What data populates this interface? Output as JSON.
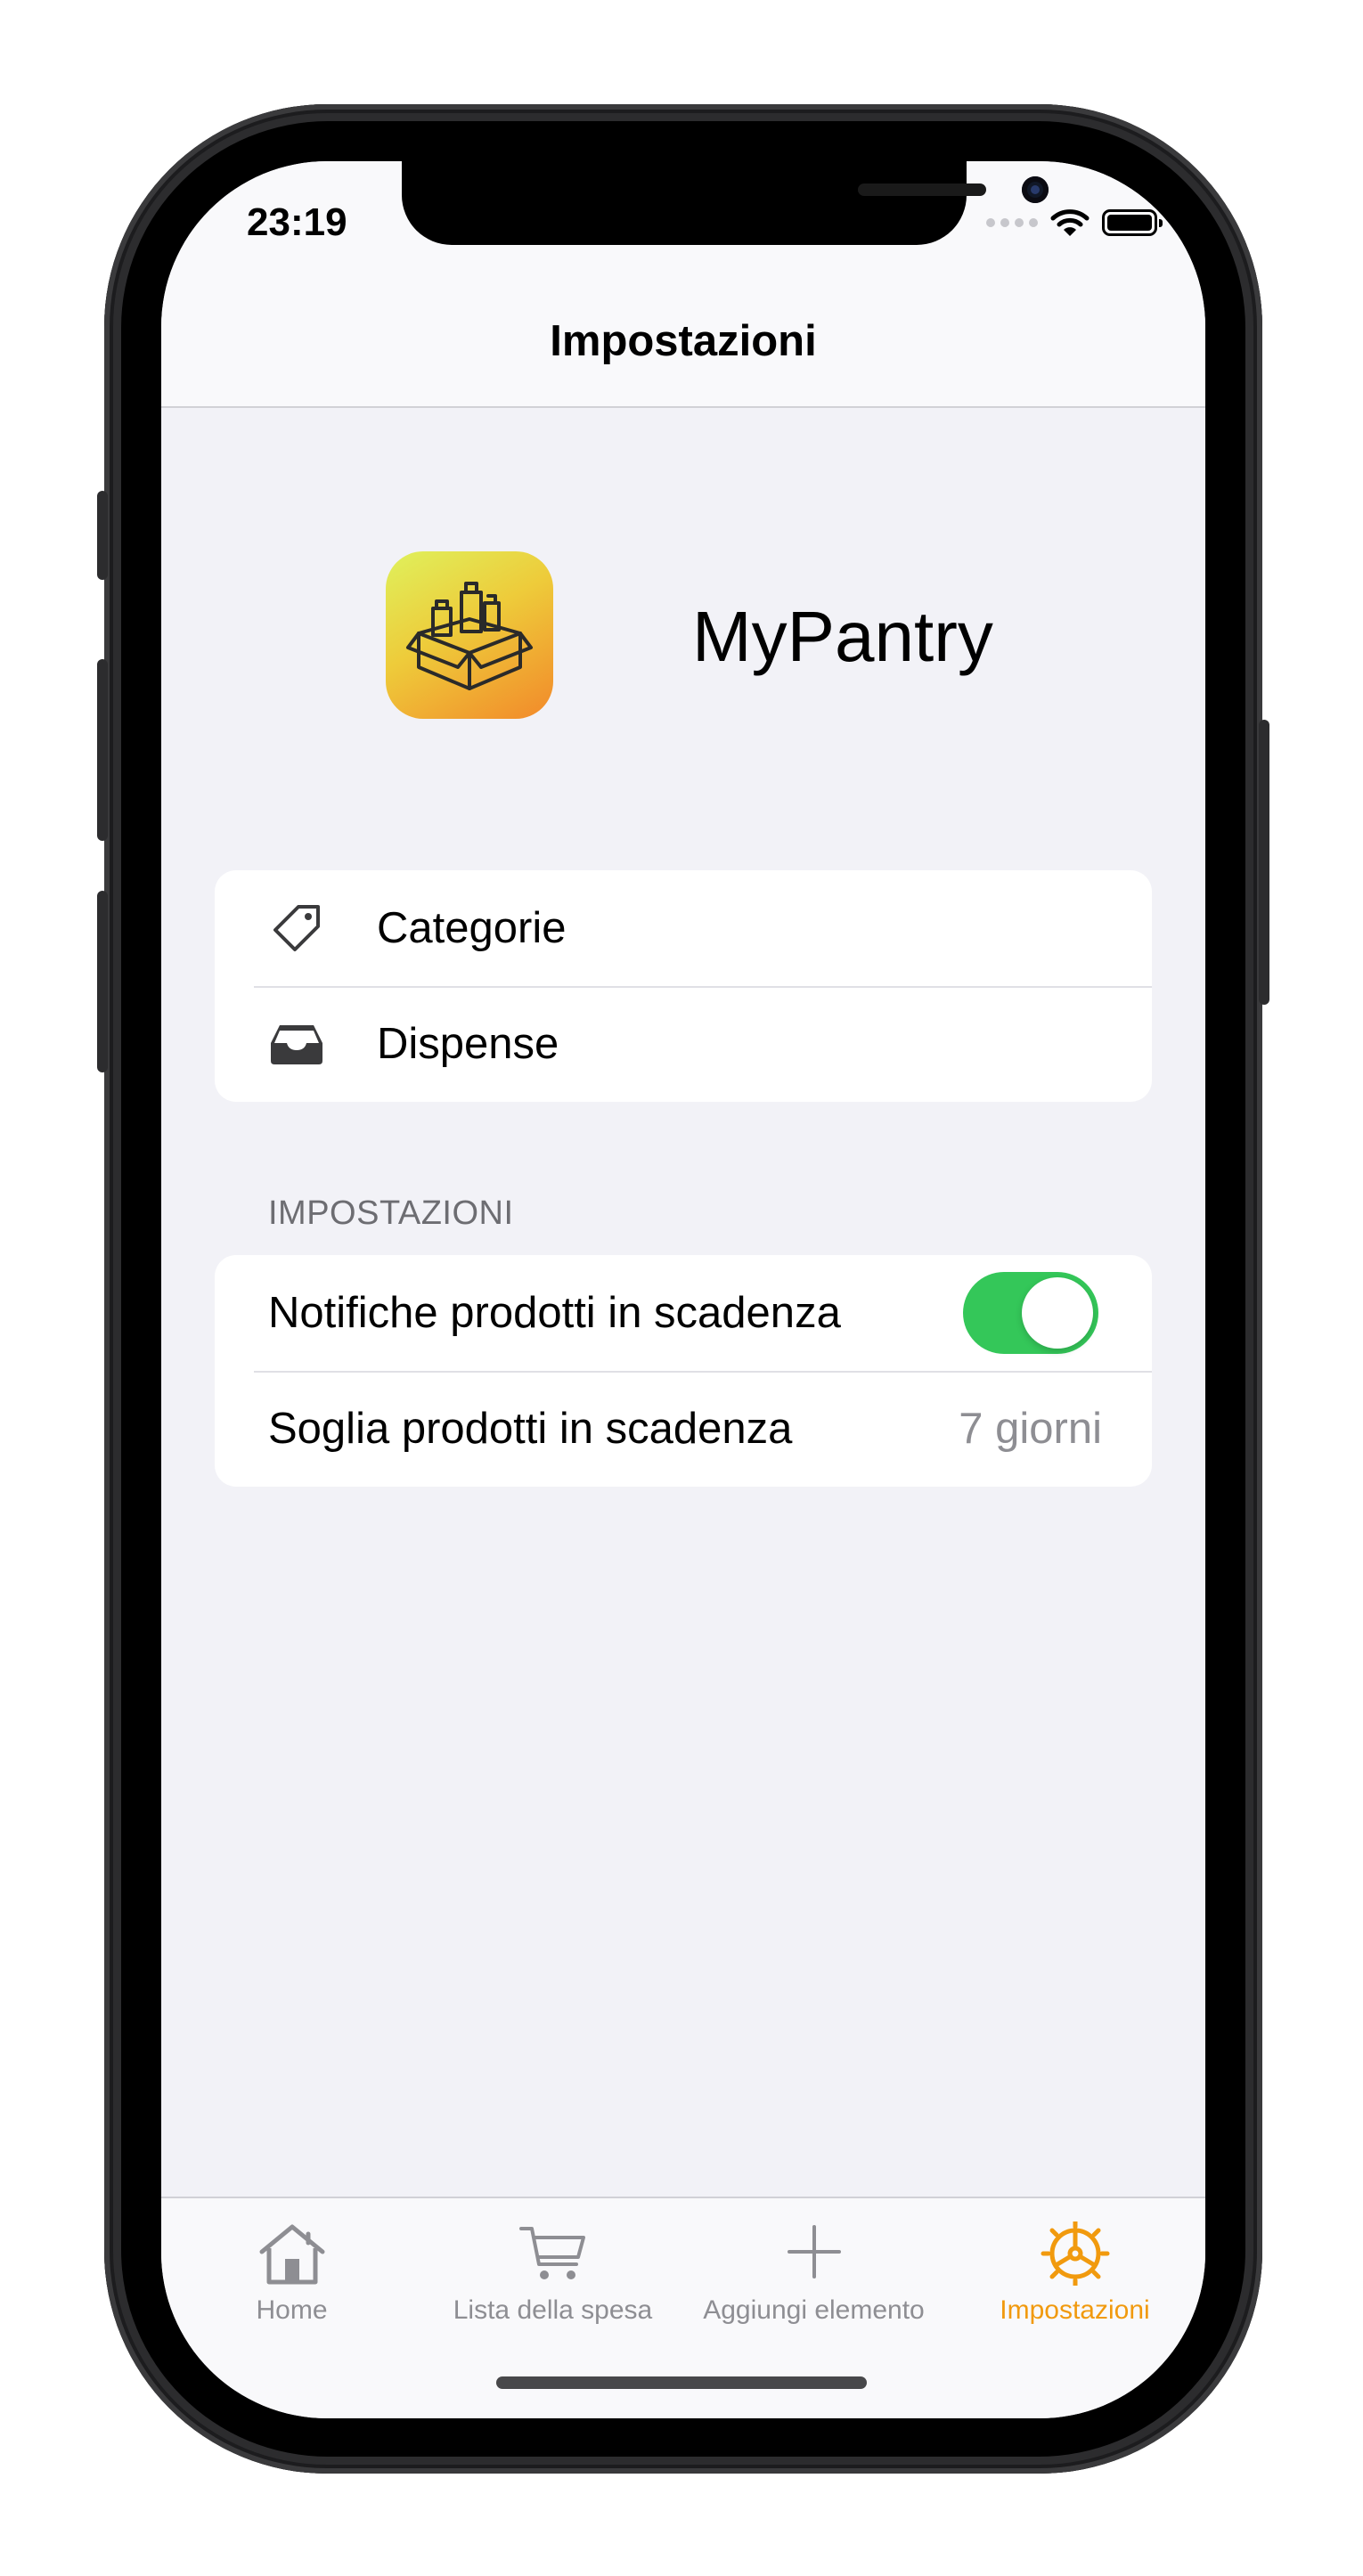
{
  "status_bar": {
    "time": "23:19"
  },
  "nav": {
    "title": "Impostazioni"
  },
  "app": {
    "name": "MyPantry",
    "icon": "pantry-box-icon",
    "icon_gradient": [
      "#dff15c",
      "#eecb3a",
      "#f2892a"
    ]
  },
  "menu": {
    "items": [
      {
        "label": "Categorie",
        "icon": "tag-icon"
      },
      {
        "label": "Dispense",
        "icon": "tray-icon"
      }
    ]
  },
  "settings": {
    "header": "IMPOSTAZIONI",
    "notifications_label": "Notifiche prodotti in scadenza",
    "notifications_enabled": true,
    "threshold_label": "Soglia prodotti in scadenza",
    "threshold_value": "7 giorni"
  },
  "tabs": [
    {
      "label": "Home",
      "icon": "house-icon",
      "active": false
    },
    {
      "label": "Lista della spesa",
      "icon": "cart-icon",
      "active": false
    },
    {
      "label": "Aggiungi elemento",
      "icon": "plus-icon",
      "active": false
    },
    {
      "label": "Impostazioni",
      "icon": "gear-icon",
      "active": true
    }
  ],
  "colors": {
    "accent": "#f19a0e",
    "toggle_on": "#34c759",
    "background": "#f2f2f7"
  }
}
